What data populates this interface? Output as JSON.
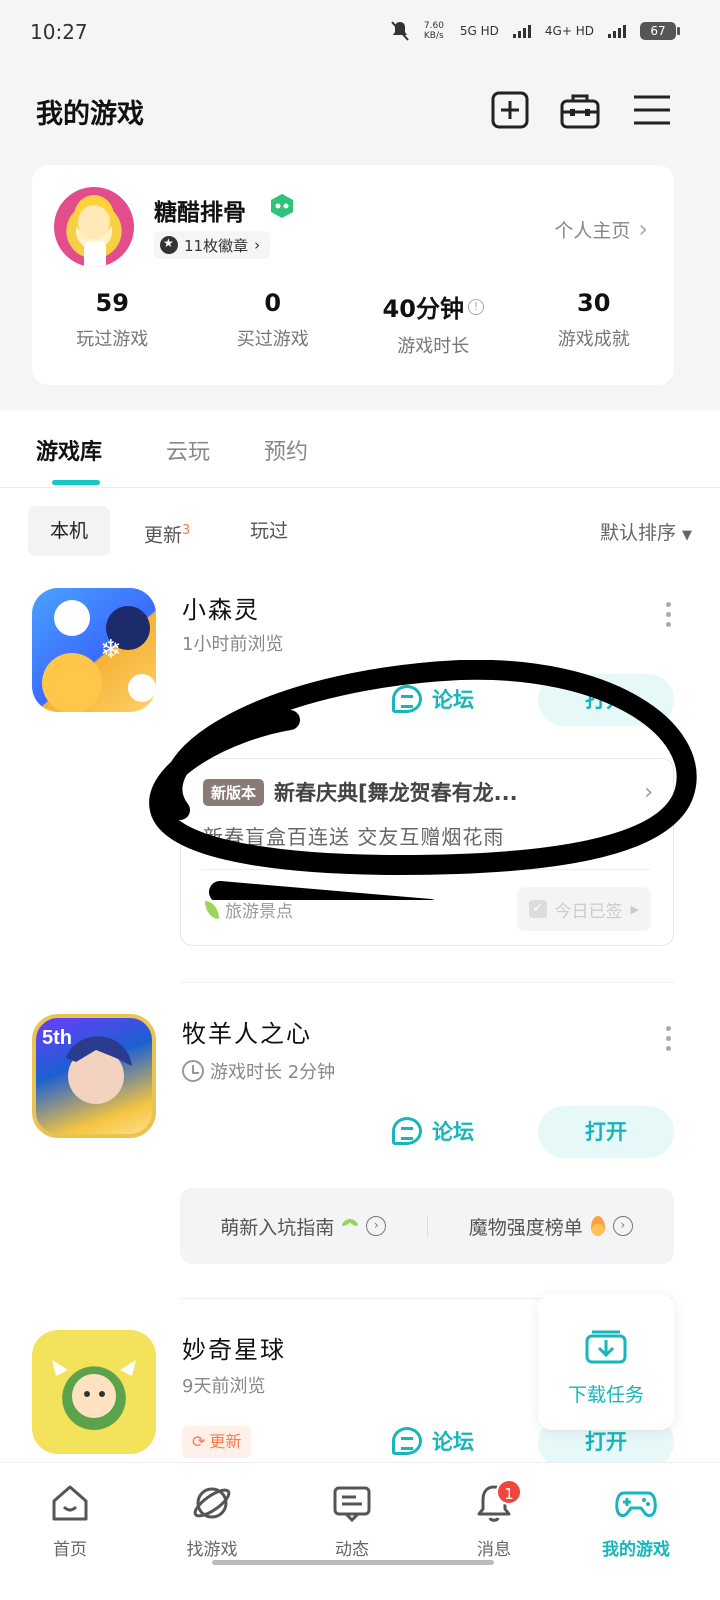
{
  "status": {
    "time": "10:27",
    "net_speed": "7.60 KB/s",
    "net1": "5G HD",
    "net2": "4G+ HD",
    "battery": "67"
  },
  "header": {
    "title": "我的游戏"
  },
  "profile": {
    "name": "糖醋排骨",
    "badges": "11枚徽章",
    "home_link": "个人主页",
    "stats": [
      {
        "value": "59",
        "label": "玩过游戏"
      },
      {
        "value": "0",
        "label": "买过游戏"
      },
      {
        "value": "40分钟",
        "label": "游戏时长"
      },
      {
        "value": "30",
        "label": "游戏成就"
      }
    ]
  },
  "tabs": [
    "游戏库",
    "云玩",
    "预约"
  ],
  "filters": {
    "items": [
      "本机",
      "更新",
      "玩过"
    ],
    "update_count": "3",
    "sort": "默认排序"
  },
  "games": [
    {
      "name": "小森灵",
      "sub": "1小时前浏览",
      "forum": "论坛",
      "open": "打开",
      "update": {
        "tag": "新版本",
        "title": "新春庆典[舞龙贺春有龙...",
        "desc": "新春盲盒百连送 交友互赠烟花雨",
        "left": "旅游景点",
        "checkin": "今日已签"
      }
    },
    {
      "name": "牧羊人之心",
      "sub": "游戏时长 2分钟",
      "forum": "论坛",
      "open": "打开",
      "guides": [
        "萌新入坑指南",
        "魔物强度榜单"
      ]
    },
    {
      "name": "妙奇星球",
      "sub": "9天前浏览",
      "tag": "更新",
      "forum": "论坛",
      "open": "打开"
    }
  ],
  "download_task": "下载任务",
  "tabbar": {
    "items": [
      "首页",
      "找游戏",
      "动态",
      "消息",
      "我的游戏"
    ],
    "message_badge": "1"
  },
  "colors": {
    "accent": "#18b5bb",
    "badge_red": "#f0443d"
  }
}
